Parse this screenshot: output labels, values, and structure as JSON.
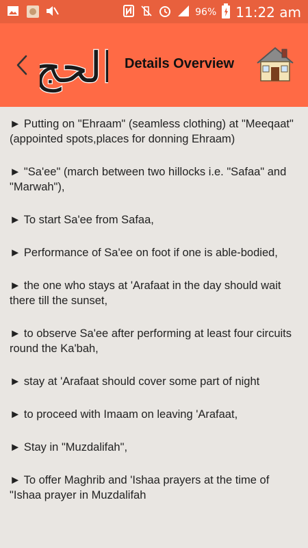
{
  "status_bar": {
    "left_icons": [
      "image-icon",
      "app-thumbnail-icon",
      "mute-icon"
    ],
    "right_icons": [
      "nfc-icon",
      "vibrate-off-icon",
      "alarm-icon",
      "signal-icon"
    ],
    "battery_percent": "96%",
    "time": "11:22 am"
  },
  "toolbar": {
    "title": "Details Overview",
    "logo_text": "الحج",
    "back_icon": "chevron-left-icon",
    "home_icon": "home-icon"
  },
  "items": [
    "► Putting on \"Ehraam\" (seamless clothing) at \"Meeqaat\" (appointed spots,places for donning Ehraam)",
    "►  \"Sa'ee\" (march between two hillocks i.e. \"Safaa\" and \"Marwah\"),",
    "► To start Sa'ee from Safaa,",
    "► Performance of Sa'ee on foot if one is able-bodied,",
    "► the one who stays at 'Arafaat in the day should wait there till the sunset,",
    "► to observe Sa'ee after performing at least four circuits round the Ka'bah,",
    "► stay at 'Arafaat should cover some part of night",
    "► to proceed with Imaam on leaving 'Arafaat,",
    "► Stay in \"Muzdalifah\",",
    "► To offer Maghrib and 'Ishaa prayers at the time of \"Ishaa prayer in Muzdalifah"
  ]
}
